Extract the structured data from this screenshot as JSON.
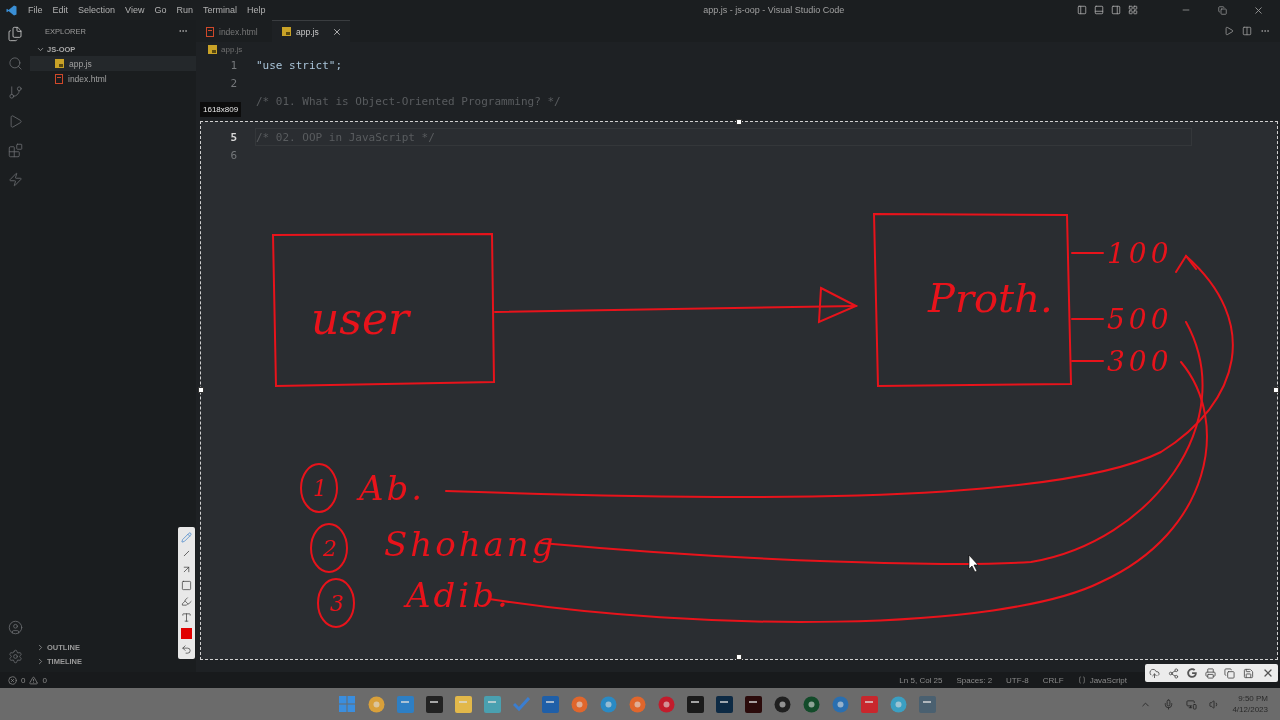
{
  "title_bar": {
    "menu": [
      "File",
      "Edit",
      "Selection",
      "View",
      "Go",
      "Run",
      "Terminal",
      "Help"
    ],
    "title": "app.js - js-oop - Visual Studio Code"
  },
  "sidebar": {
    "header": "EXPLORER",
    "folder": {
      "name": "JS-OOP",
      "expanded": true
    },
    "files": [
      {
        "name": "app.js",
        "kind": "js",
        "selected": true
      },
      {
        "name": "index.html",
        "kind": "html",
        "selected": false
      }
    ],
    "sections": [
      {
        "label": "OUTLINE",
        "expanded": false
      },
      {
        "label": "TIMELINE",
        "expanded": false
      }
    ]
  },
  "tabs": [
    {
      "label": "index.html",
      "kind": "html",
      "selected": false
    },
    {
      "label": "app.js",
      "kind": "js",
      "selected": true
    }
  ],
  "breadcrumb": {
    "label": "app.js",
    "kind": "js"
  },
  "code_lines": [
    {
      "number": "1",
      "text": "\"use strict\";",
      "kind": "string",
      "current": false
    },
    {
      "number": "2",
      "current": false
    },
    {
      "text": "/* 01. What is Object-Oriented Programming? */",
      "kind": "comment",
      "current": false
    },
    {
      "current": false
    },
    {
      "number": "5",
      "text": "/* 02. OOP in JavaScript */",
      "kind": "comment",
      "current": true
    },
    {
      "number": "6",
      "current": false
    }
  ],
  "capture": {
    "size_label": "1618x809",
    "sketch": {
      "left_box": "user",
      "right_box": "Proth.",
      "prices": [
        "100",
        "500",
        "300"
      ],
      "people": [
        {
          "number": "1",
          "name": "Ab."
        },
        {
          "number": "2",
          "name": "Shohang"
        },
        {
          "number": "3",
          "name": "Adib."
        }
      ]
    }
  },
  "status_bar": {
    "errors": "0",
    "warnings": "0",
    "items": [
      "Ln 5, Col 25",
      "Spaces: 2",
      "UTF-8",
      "CRLF",
      "JavaScript"
    ]
  },
  "taskbar": {
    "time": "9:50 PM",
    "date": "4/12/2023"
  }
}
